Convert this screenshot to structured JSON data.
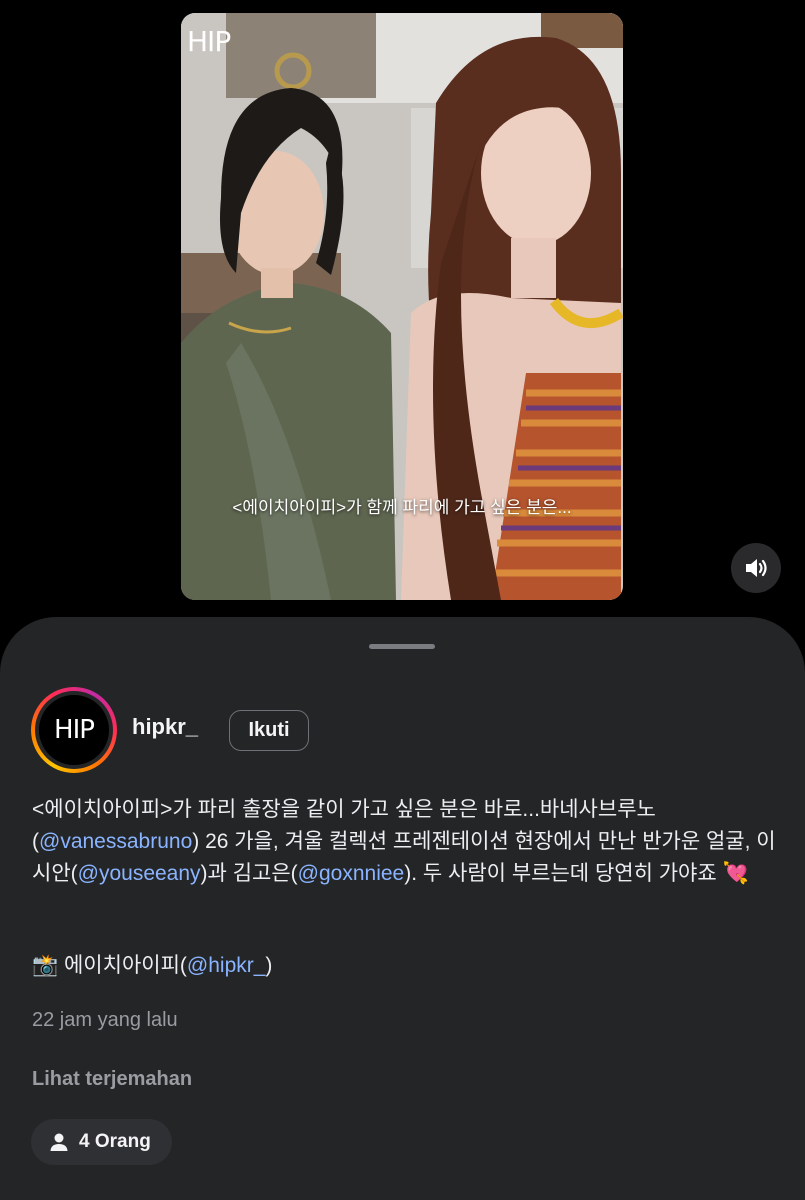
{
  "video": {
    "logo": "HIP",
    "caption": "<에이치아이피>가 함께 파리에 가고 싶은 분은...",
    "sound_icon": "volume-icon"
  },
  "post": {
    "avatar_text": "HIP",
    "username": "hipkr_",
    "follow_label": "Ikuti",
    "desc": {
      "p1": "<에이치아이피>가 파리 출장을 같이 가고 싶은 분은 바로...바네사브루노 (",
      "m1": "@vanessabruno",
      "p2": ") 26 가을, 겨울 컬렉션 프레젠테이션 현장에서 만난 반가운 얼굴, 이시안(",
      "m2": "@youseeany",
      "p3": ")과 김고은(",
      "m3": "@goxnniee",
      "p4": "). 두 사람이 부르는데 당연히 가야죠 💘"
    },
    "credit": {
      "prefix": "📸 에이치아이피(",
      "mention": "@hipkr_",
      "suffix": ")"
    },
    "time": "22 jam yang lalu",
    "translate": "Lihat terjemahan",
    "people": "4 Orang"
  }
}
